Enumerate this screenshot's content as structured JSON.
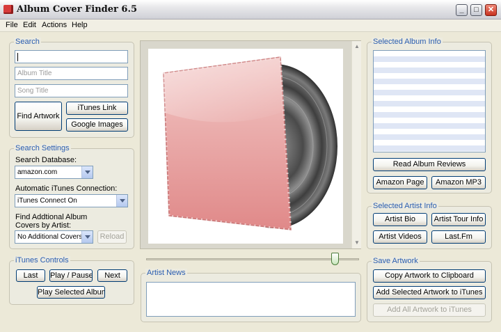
{
  "window": {
    "title": "Album Cover Finder 6.5"
  },
  "menu": [
    "File",
    "Edit",
    "Actions",
    "Help"
  ],
  "search": {
    "title": "Search",
    "artist_value": "",
    "album_placeholder": "Album Title",
    "song_placeholder": "Song Title",
    "find_label": "Find Artwork",
    "itunes_link_label": "iTunes Link",
    "google_images_label": "Google Images"
  },
  "settings": {
    "title": "Search Settings",
    "database_label": "Search Database:",
    "database_value": "amazon.com",
    "itunes_conn_label": "Automatic iTunes Connection:",
    "itunes_conn_value": "iTunes Connect On",
    "additional_label_line1": "Find Addtional Album",
    "additional_label_line2": "Covers by Artist:",
    "additional_value": "No Additional Covers",
    "reload_label": "Reload"
  },
  "itunes": {
    "title": "iTunes Controls",
    "last_label": "Last",
    "play_pause_label": "Play / Pause",
    "next_label": "Next",
    "play_selected_label": "Play Selected Album"
  },
  "artwork": {
    "zoom_fraction": 0.9
  },
  "news": {
    "title": "Artist News"
  },
  "album_info": {
    "title": "Selected Album Info",
    "read_reviews_label": "Read Album Reviews",
    "amazon_page_label": "Amazon Page",
    "amazon_mp3_label": "Amazon MP3"
  },
  "artist_info": {
    "title": "Selected Artist Info",
    "bio_label": "Artist Bio",
    "tour_label": "Artist Tour Info",
    "videos_label": "Artist Videos",
    "lastfm_label": "Last.Fm"
  },
  "save": {
    "title": "Save Artwork",
    "copy_label": "Copy Artwork to Clipboard",
    "add_selected_label": "Add Selected Artwork to iTunes",
    "add_all_label": "Add All Artwork to iTunes"
  },
  "colors": {
    "accent": "#2a5db0",
    "sleeve": "#e38a8a",
    "vinyl": "#555555",
    "label": "#f2dc8a"
  },
  "icons": [
    "app-record-icon",
    "minimize-icon",
    "maximize-icon",
    "close-icon"
  ]
}
